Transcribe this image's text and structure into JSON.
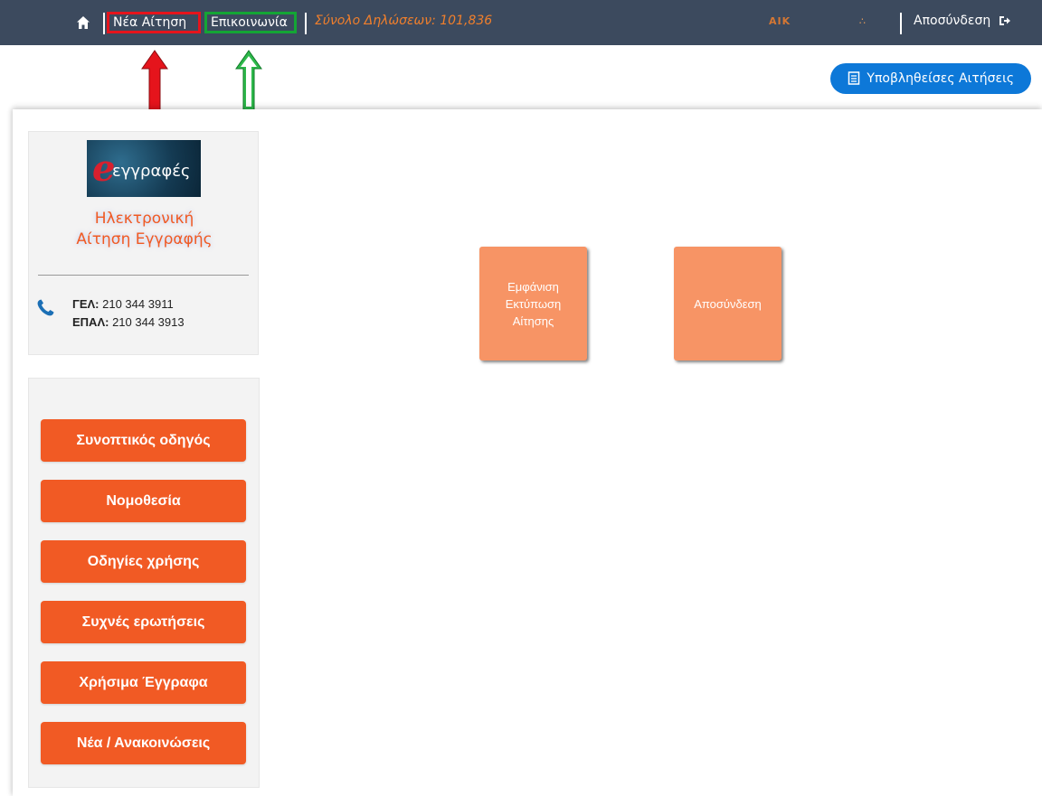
{
  "navbar": {
    "home_icon": "home-icon",
    "new_application": "Νέα Αίτηση",
    "contact": "Επικοινωνία",
    "total_declarations": "Σύνολο Δηλώσεων: 101,836",
    "user_name": "ΑΙΚ",
    "logout": "Αποσύνδεση",
    "logout_icon": "sign-out-icon"
  },
  "submitted_button": {
    "label": "Υποβληθείσες Αιτήσεις",
    "icon": "document-icon"
  },
  "annotations": {
    "arrow_red_color": "#e5141c",
    "arrow_green_color": "#14a535"
  },
  "logo_panel": {
    "logo_word": "εγγραφές",
    "title_line1": "Ηλεκτρονική",
    "title_line2": "Αίτηση Εγγραφής",
    "phone_gel_label": "ΓΕΛ:",
    "phone_gel_number": "210 344 3911",
    "phone_epal_label": "ΕΠΑΛ:",
    "phone_epal_number": "210 344 3913"
  },
  "menu": [
    "Συνοπτικός οδηγός",
    "Νομοθεσία",
    "Οδηγίες χρήσης",
    "Συχνές ερωτήσεις",
    "Χρήσιμα Έγγραφα",
    "Νέα / Ανακοινώσεις"
  ],
  "tiles": {
    "view_print": [
      "Εμφάνιση",
      "Εκτύπωση",
      "Αίτησης"
    ],
    "logout": "Αποσύνδεση"
  },
  "colors": {
    "navbar_bg": "#3c4a5e",
    "accent_orange": "#f15a24",
    "tile_orange": "#f79465",
    "primary_blue": "#0d78d8"
  }
}
